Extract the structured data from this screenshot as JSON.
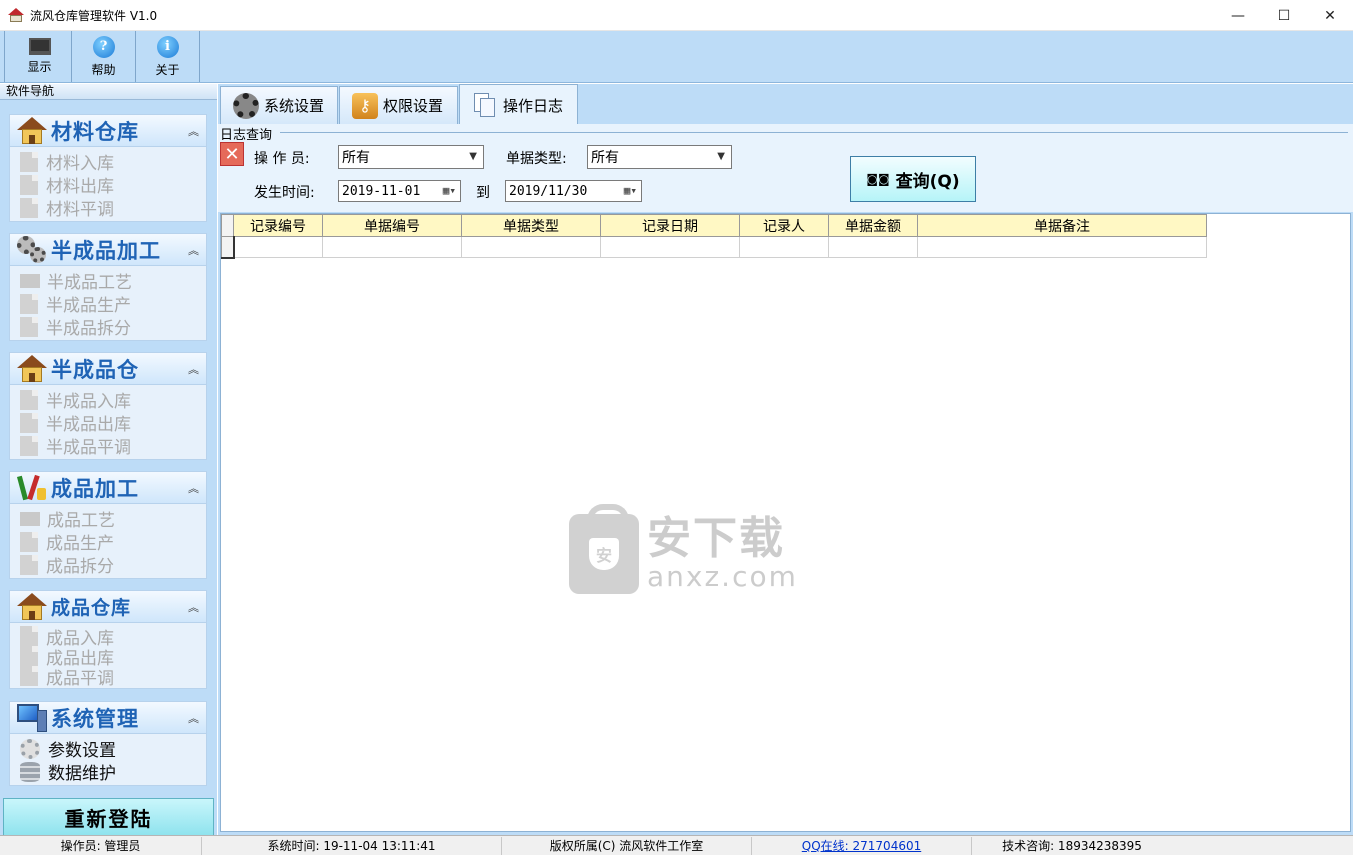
{
  "window": {
    "title": "流风仓库管理软件 V1.0",
    "controls": {
      "minimize": "—",
      "maximize": "☐",
      "close": "✕"
    }
  },
  "toolbar": [
    {
      "label": "显示",
      "icon": "monitor-icon"
    },
    {
      "label": "帮助",
      "icon": "help-icon",
      "glyph": "?"
    },
    {
      "label": "关于",
      "icon": "info-icon",
      "glyph": "i"
    }
  ],
  "nav": {
    "header": "软件导航",
    "groups": [
      {
        "title": "材料仓库",
        "icon": "warehouse-icon",
        "items": [
          "材料入库",
          "材料出库",
          "材料平调"
        ]
      },
      {
        "title": "半成品加工",
        "icon": "gears-icon",
        "items": [
          "半成品工艺",
          "半成品生产",
          "半成品拆分"
        ]
      },
      {
        "title": "半成品仓",
        "icon": "warehouse-icon",
        "items": [
          "半成品入库",
          "半成品出库",
          "半成品平调"
        ]
      },
      {
        "title": "成品加工",
        "icon": "tools-icon",
        "items": [
          "成品工艺",
          "成品生产",
          "成品拆分"
        ]
      },
      {
        "title": "成品仓库",
        "icon": "warehouse-icon",
        "items": [
          "成品入库",
          "成品出库",
          "成品平调"
        ]
      },
      {
        "title": "系统管理",
        "icon": "computer-icon",
        "items": [
          "参数设置",
          "数据维护"
        ]
      }
    ],
    "collapse_glyph": "︽",
    "relogin": "重新登陆"
  },
  "tabs": [
    {
      "label": "系统设置",
      "icon": "gear-icon"
    },
    {
      "label": "权限设置",
      "icon": "key-icon",
      "glyph": "⚷"
    },
    {
      "label": "操作日志",
      "icon": "log-icon"
    }
  ],
  "query": {
    "legend": "日志查询",
    "operator_label": "操 作 员:",
    "operator_value": "所有",
    "doc_type_label": "单据类型:",
    "doc_type_value": "所有",
    "time_label": "发生时间:",
    "date_from": "2019-11-01",
    "to_label": "到",
    "date_to": "2019/11/30",
    "query_button": "查询(Q)",
    "clear_glyph": "✕"
  },
  "grid": {
    "columns": [
      "记录编号",
      "单据编号",
      "单据类型",
      "记录日期",
      "记录人",
      "单据金额",
      "单据备注"
    ]
  },
  "watermark": {
    "cn": "安下载",
    "en": "anxz.com",
    "shield": "安"
  },
  "statusbar": {
    "operator": "操作员: 管理员",
    "system_time": "系统时间: 19-11-04 13:11:41",
    "copyright": "版权所属(C) 流风软件工作室",
    "qq": "QQ在线: 271704601",
    "support": "技术咨询: 18934238395"
  }
}
